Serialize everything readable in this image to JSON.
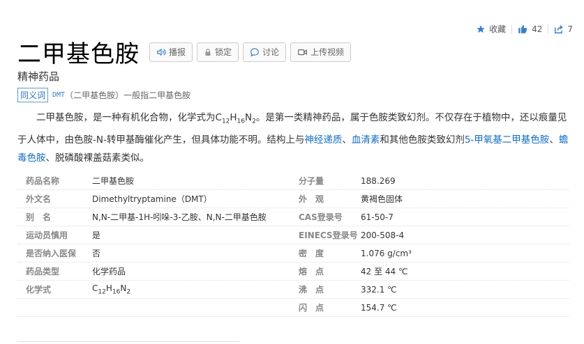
{
  "top_actions": {
    "favorite": "收藏",
    "like_count": "42",
    "share_count": "7"
  },
  "title": "二甲基色胺",
  "buttons": {
    "play": "播报",
    "lock": "锁定",
    "discuss": "讨论",
    "upload": "上传视频"
  },
  "subtitle": "精神药品",
  "synonym": {
    "tag": "同义词",
    "link": "DMT",
    "text": "（二甲基色胺）一般指二甲基色胺"
  },
  "summary": {
    "p1": "二甲基色胺，是一种有机化合物，化学式为C",
    "f_c": "12",
    "f_h_pre": "H",
    "f_h": "16",
    "f_n_pre": "N",
    "f_n": "2",
    "p2": "。是第一类精神药品，属于色胺类致幻剂。不仅存在于植物中，还以痕量见于人体中，由色胺-N-转甲基酶催化产生，但具体功能不明。结构上与",
    "link1": "神经递质",
    "sep1": "、",
    "link2": "血清素",
    "p3": "和其他色胺类致幻剂",
    "link3": "5-甲氧基二甲基色胺",
    "sep2": "、",
    "link4": "蟾毒色胺",
    "p4": "、脱磷酸裸盖菇素类似。"
  },
  "info": {
    "rows": [
      {
        "l_label": "药品名称",
        "l_value": "二甲基色胺",
        "r_label": "分子量",
        "r_value": "188.269"
      },
      {
        "l_label": "外文名",
        "l_value": "Dimethyltryptamine（DMT）",
        "r_label": "外　观",
        "r_value": "黄褐色固体"
      },
      {
        "l_label": "别　名",
        "l_value": "N,N-二甲基-1H-吲哚-3-乙胺、N,N-二甲基色胺",
        "r_label": "CAS登录号",
        "r_value": "61-50-7"
      },
      {
        "l_label": "运动员慎用",
        "l_value": "是",
        "r_label": "EINECS登录号",
        "r_value": "200-508-4"
      },
      {
        "l_label": "是否纳入医保",
        "l_value": "否",
        "r_label": "密　度",
        "r_value": "1.076 g/cm³"
      },
      {
        "l_label": "药品类型",
        "l_value": "化学药品",
        "r_label": "熔　点",
        "r_value": "42 至 44 ℃"
      },
      {
        "l_label": "化学式",
        "l_value": "",
        "r_label": "沸　点",
        "r_value": "332.1 ℃"
      },
      {
        "l_label": "",
        "l_value": "",
        "r_label": "闪　点",
        "r_value": "154.7 ℃"
      }
    ],
    "formula": {
      "c": "C",
      "c_n": "12",
      "h": "H",
      "h_n": "16",
      "n": "N",
      "n_n": "2"
    }
  },
  "colors": {
    "link": "#136ec2",
    "icon_blue": "#3a7fc8"
  }
}
